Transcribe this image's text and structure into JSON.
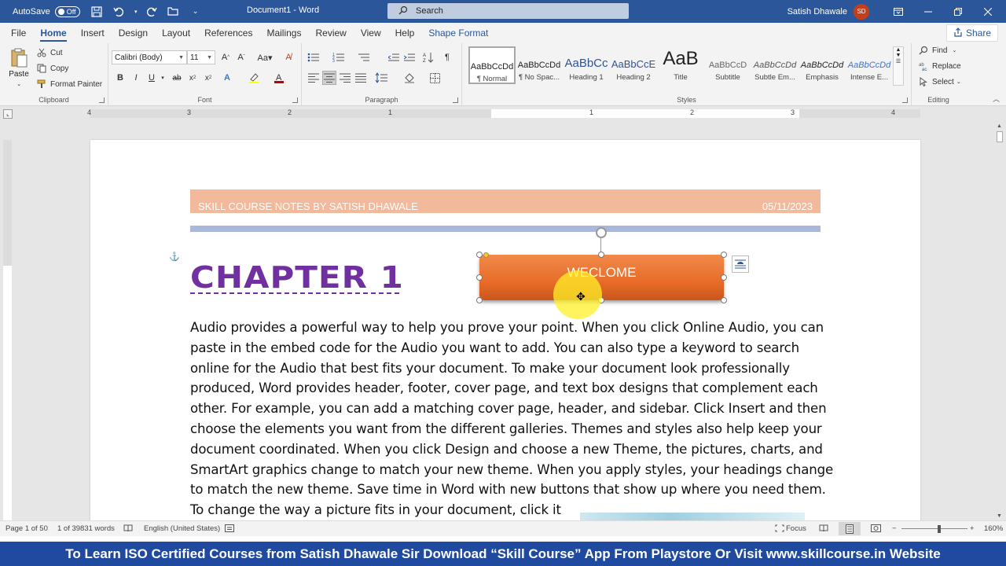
{
  "titlebar": {
    "autosave_label": "AutoSave",
    "autosave_state": "Off",
    "document_title": "Document1  -  Word",
    "search_placeholder": "Search",
    "user_name": "Satish Dhawale",
    "user_initials": "SD"
  },
  "tabs": [
    {
      "label": "File"
    },
    {
      "label": "Home"
    },
    {
      "label": "Insert"
    },
    {
      "label": "Design"
    },
    {
      "label": "Layout"
    },
    {
      "label": "References"
    },
    {
      "label": "Mailings"
    },
    {
      "label": "Review"
    },
    {
      "label": "View"
    },
    {
      "label": "Help"
    },
    {
      "label": "Shape Format"
    }
  ],
  "share_label": "Share",
  "ribbon": {
    "clipboard": {
      "paste": "Paste",
      "cut": "Cut",
      "copy": "Copy",
      "format_painter": "Format Painter",
      "label": "Clipboard"
    },
    "font": {
      "font_name": "Calibri (Body)",
      "font_size": "11",
      "label": "Font"
    },
    "paragraph": {
      "label": "Paragraph"
    },
    "styles": {
      "label": "Styles",
      "items": [
        {
          "preview": "AaBbCcDd",
          "name": "¶ Normal"
        },
        {
          "preview": "AaBbCcDd",
          "name": "¶ No Spac..."
        },
        {
          "preview": "AaBbCc",
          "name": "Heading 1"
        },
        {
          "preview": "AaBbCcE",
          "name": "Heading 2"
        },
        {
          "preview": "AaB",
          "name": "Title"
        },
        {
          "preview": "AaBbCcD",
          "name": "Subtitle"
        },
        {
          "preview": "AaBbCcDd",
          "name": "Subtle Em..."
        },
        {
          "preview": "AaBbCcDd",
          "name": "Emphasis"
        },
        {
          "preview": "AaBbCcDd",
          "name": "Intense E..."
        }
      ]
    },
    "editing": {
      "find": "Find",
      "replace": "Replace",
      "select": "Select",
      "label": "Editing"
    }
  },
  "ruler_numbers": [
    "4",
    "3",
    "2",
    "1",
    "1",
    "2",
    "3",
    "4"
  ],
  "document": {
    "header_left": "SKILL COURSE NOTES BY SATISH DHAWALE",
    "header_right": "05/11/2023",
    "chapter_heading": "CHAPTER 1",
    "shape_text": "WECLOME",
    "body_lines": [
      "Audio provides a powerful way to help you prove your point. When you click Online Audio, you can",
      "paste in the embed code for the Audio you want to add. You can also type a keyword to search",
      "online for the Audio that best fits your document. To make your document look professionally",
      "produced, Word provides header, footer, cover page, and text box designs that complement each",
      "other. For example, you can add a matching cover page, header, and sidebar. Click Insert and then",
      "choose the elements you want from the different galleries. Themes and styles also help keep your",
      "document coordinated. When you click Design and choose a new Theme, the pictures, charts, and",
      "SmartArt graphics change to match your new theme. When you apply styles, your headings change",
      "to match the new theme. Save time in Word with new buttons that show up where you need them.",
      "To change the way a picture fits in your document, click it"
    ]
  },
  "statusbar": {
    "page": "Page 1 of 50",
    "words": "1 of 39831 words",
    "language": "English (United States)",
    "focus": "Focus",
    "zoom": "160%"
  },
  "banner_text": "To Learn ISO Certified Courses from Satish Dhawale Sir Download “Skill Course” App From Playstore Or Visit www.skillcourse.in Website",
  "colors": {
    "title_bar": "#2b579a",
    "header_band": "#f2b99a",
    "chapter": "#7030a0",
    "shape_fill": "#e86c28",
    "banner": "#1f4aa0"
  }
}
